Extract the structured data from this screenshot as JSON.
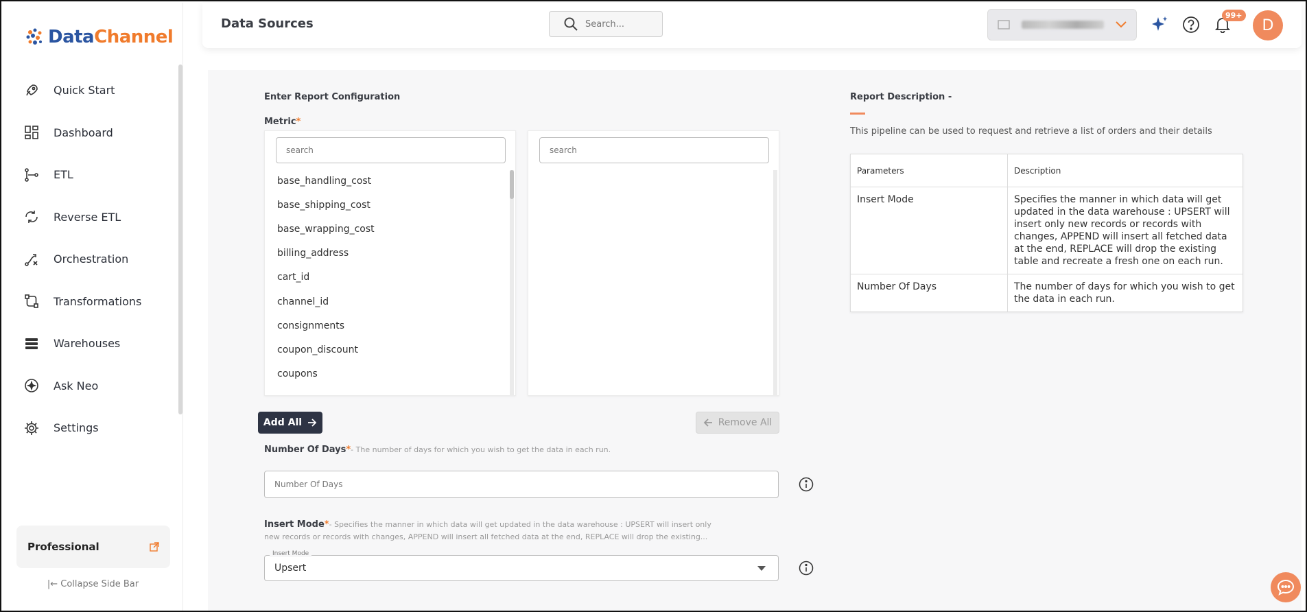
{
  "brand": {
    "name_part1": "Data",
    "name_part2": "Channel"
  },
  "sidebar": {
    "items": [
      {
        "label": "Quick Start",
        "icon": "rocket-icon"
      },
      {
        "label": "Dashboard",
        "icon": "dashboard-grid-icon"
      },
      {
        "label": "ETL",
        "icon": "etl-flow-icon"
      },
      {
        "label": "Reverse ETL",
        "icon": "reverse-etl-icon"
      },
      {
        "label": "Orchestration",
        "icon": "orchestration-icon"
      },
      {
        "label": "Transformations",
        "icon": "transformations-icon"
      },
      {
        "label": "Warehouses",
        "icon": "warehouses-icon"
      },
      {
        "label": "Ask Neo",
        "icon": "sparkle-icon"
      },
      {
        "label": "Settings",
        "icon": "gear-icon"
      }
    ],
    "plan": "Professional",
    "collapse_label": "Collapse Side Bar"
  },
  "header": {
    "title": "Data Sources",
    "search_placeholder": "Search...",
    "notifications_badge": "99+",
    "avatar_initial": "D"
  },
  "form": {
    "heading": "Enter Report Configuration",
    "metric_label": "Metric",
    "required_mark": "*",
    "available_search_placeholder": "search",
    "selected_search_placeholder": "search",
    "available_metrics": [
      "base_handling_cost",
      "base_shipping_cost",
      "base_wrapping_cost",
      "billing_address",
      "cart_id",
      "channel_id",
      "consignments",
      "coupon_discount",
      "coupons"
    ],
    "add_all_label": "Add All",
    "remove_all_label": "Remove All",
    "days_label": "Number Of Days",
    "days_help": "- The number of days for which you wish to get the data in each run.",
    "days_placeholder": "Number Of Days",
    "insert_label": "Insert Mode",
    "insert_help_line1": "- Specifies the manner in which data will get updated in the data warehouse : UPSERT will insert only",
    "insert_help_line2": "new records or records with changes, APPEND will insert all fetched data at the end, REPLACE will drop the existing...",
    "insert_legend": "Insert Mode",
    "insert_value": "Upsert"
  },
  "description": {
    "title": "Report Description -",
    "text": "This pipeline can be used to request and retrieve a list of orders and their details",
    "columns": [
      "Parameters",
      "Description"
    ],
    "rows": [
      {
        "param": "Insert Mode",
        "desc": "Specifies the manner in which data will get updated in the data warehouse : UPSERT will insert only new records or records with changes, APPEND will insert all fetched data at the end, REPLACE will drop the existing table and recreate a fresh one on each run."
      },
      {
        "param": "Number Of Days",
        "desc": "The number of days for which you wish to get the data in each run."
      }
    ]
  },
  "colors": {
    "accent": "#f08a5d",
    "brand_blue": "#2b55a1",
    "dark_button": "#2e3444"
  }
}
